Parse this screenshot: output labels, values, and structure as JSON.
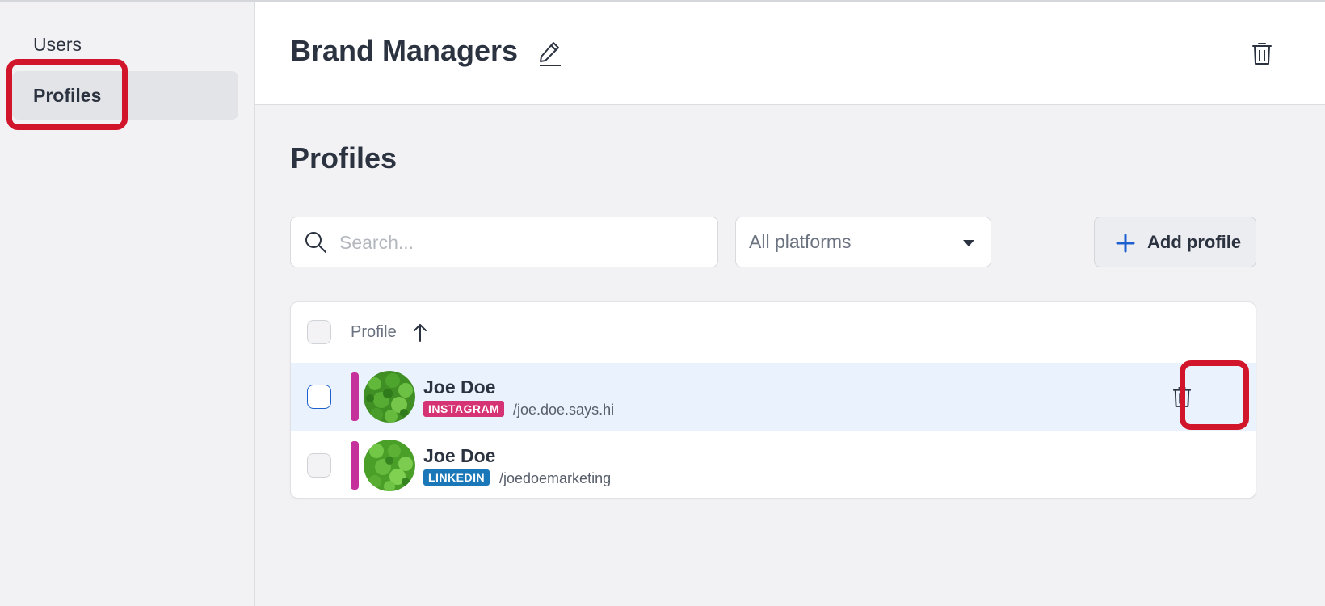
{
  "sidebar": {
    "items": [
      {
        "label": "Users",
        "active": false
      },
      {
        "label": "Profiles",
        "active": true
      }
    ]
  },
  "header": {
    "title": "Brand Managers",
    "edit_icon": "pencil-icon",
    "delete_icon": "trash-icon"
  },
  "main": {
    "section_title": "Profiles",
    "search": {
      "placeholder": "Search...",
      "value": ""
    },
    "platform_filter": {
      "selected": "All platforms"
    },
    "add_button": {
      "label": "Add profile",
      "icon": "plus-icon"
    },
    "table": {
      "column_header": "Profile",
      "sort": "ascending",
      "rows": [
        {
          "name": "Joe Doe",
          "platform": "INSTAGRAM",
          "handle": "/joe.doe.says.hi",
          "platform_color": "#d63374",
          "hovered": true
        },
        {
          "name": "Joe Doe",
          "platform": "LINKEDIN",
          "handle": "/joedoemarketing",
          "platform_color": "#1b78b8",
          "hovered": false
        }
      ]
    }
  },
  "colors": {
    "highlight": "#d1162c",
    "accent_bar": "#c6309b",
    "primary": "#1e5fd0"
  }
}
